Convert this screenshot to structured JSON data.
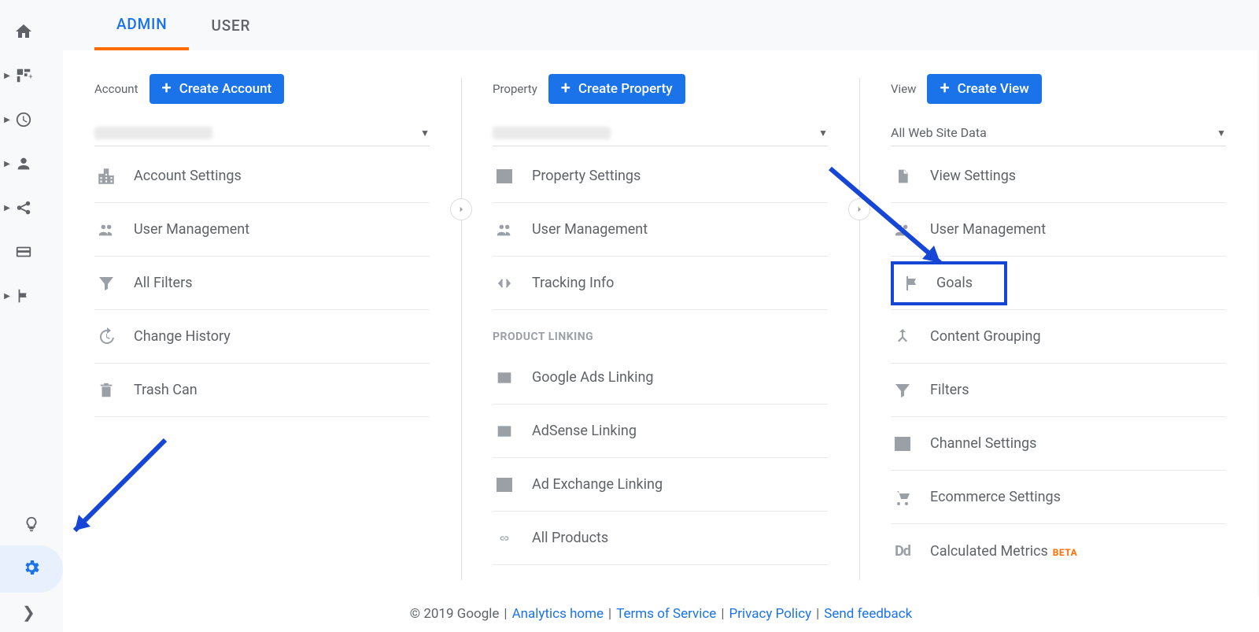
{
  "tabs": {
    "admin": "ADMIN",
    "user": "USER"
  },
  "columns": {
    "account": {
      "label": "Account",
      "button": "Create Account",
      "items": {
        "settings": "Account Settings",
        "users": "User Management",
        "filters": "All Filters",
        "history": "Change History",
        "trash": "Trash Can"
      }
    },
    "property": {
      "label": "Property",
      "button": "Create Property",
      "items": {
        "settings": "Property Settings",
        "users": "User Management",
        "tracking": "Tracking Info",
        "linking_header": "PRODUCT LINKING",
        "ads": "Google Ads Linking",
        "adsense": "AdSense Linking",
        "adx": "Ad Exchange Linking",
        "allproducts": "All Products"
      }
    },
    "view": {
      "label": "View",
      "button": "Create View",
      "selected": "All Web Site Data",
      "items": {
        "settings": "View Settings",
        "users": "User Management",
        "goals": "Goals",
        "contentgroup": "Content Grouping",
        "filters": "Filters",
        "channel": "Channel Settings",
        "ecommerce": "Ecommerce Settings",
        "calcmetrics": "Calculated Metrics",
        "calcmetrics_badge": "BETA"
      }
    }
  },
  "footer": {
    "prefix": "© 2019 Google",
    "home": "Analytics home",
    "tos": "Terms of Service",
    "privacy": "Privacy Policy",
    "feedback": "Send feedback"
  }
}
